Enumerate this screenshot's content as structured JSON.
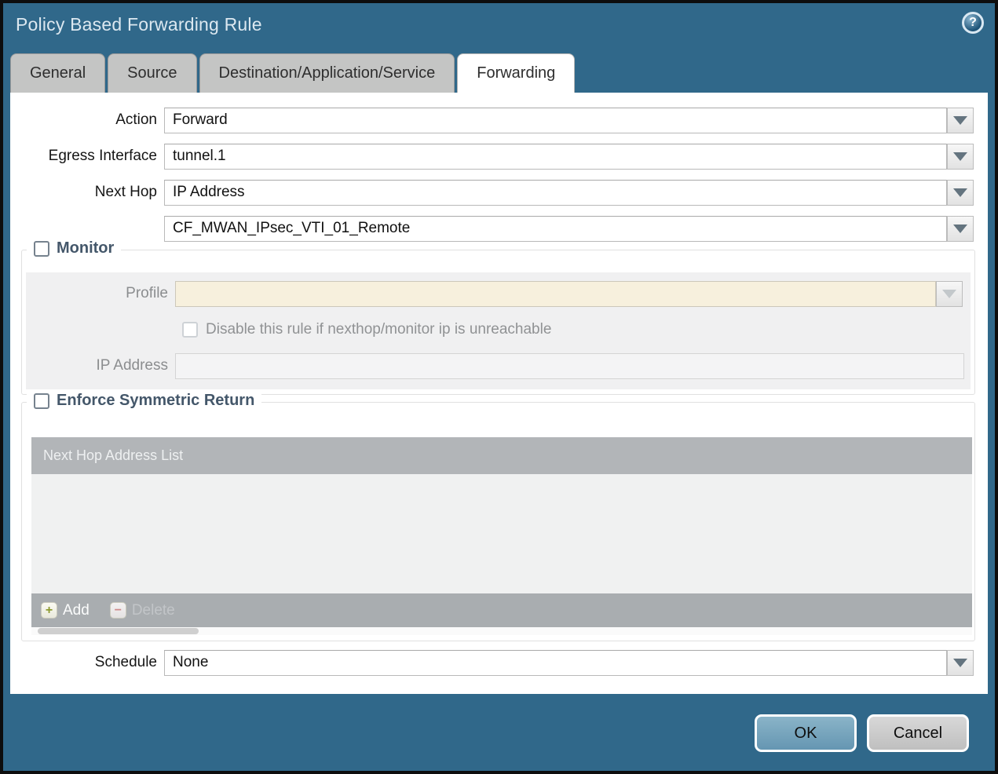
{
  "window": {
    "title": "Policy Based Forwarding Rule"
  },
  "icons": {
    "help": "?",
    "add_plus": "+",
    "delete_minus": "−"
  },
  "tabs": [
    {
      "label": "General",
      "active": false
    },
    {
      "label": "Source",
      "active": false
    },
    {
      "label": "Destination/Application/Service",
      "active": false
    },
    {
      "label": "Forwarding",
      "active": true
    }
  ],
  "form": {
    "action": {
      "label": "Action",
      "value": "Forward"
    },
    "egress_interface": {
      "label": "Egress Interface",
      "value": "tunnel.1"
    },
    "next_hop": {
      "label": "Next Hop",
      "value": "IP Address"
    },
    "next_hop_address": {
      "value": "CF_MWAN_IPsec_VTI_01_Remote"
    },
    "schedule": {
      "label": "Schedule",
      "value": "None"
    }
  },
  "monitor": {
    "title": "Monitor",
    "checked": false,
    "profile": {
      "label": "Profile",
      "value": ""
    },
    "disable_rule": {
      "label": "Disable this rule if nexthop/monitor ip is unreachable",
      "checked": false
    },
    "ip_address": {
      "label": "IP Address",
      "value": ""
    }
  },
  "symmetric_return": {
    "title": "Enforce Symmetric Return",
    "checked": false,
    "table": {
      "header": "Next Hop Address List",
      "rows": []
    },
    "add_label": "Add",
    "delete_label": "Delete"
  },
  "footer": {
    "ok_label": "OK",
    "cancel_label": "Cancel"
  },
  "colors": {
    "teal": "#30688a",
    "profile_disabled_bg": "#f7f0dd",
    "ok_button": "#74a6bf",
    "table_header_bg": "#b2b5b8"
  }
}
